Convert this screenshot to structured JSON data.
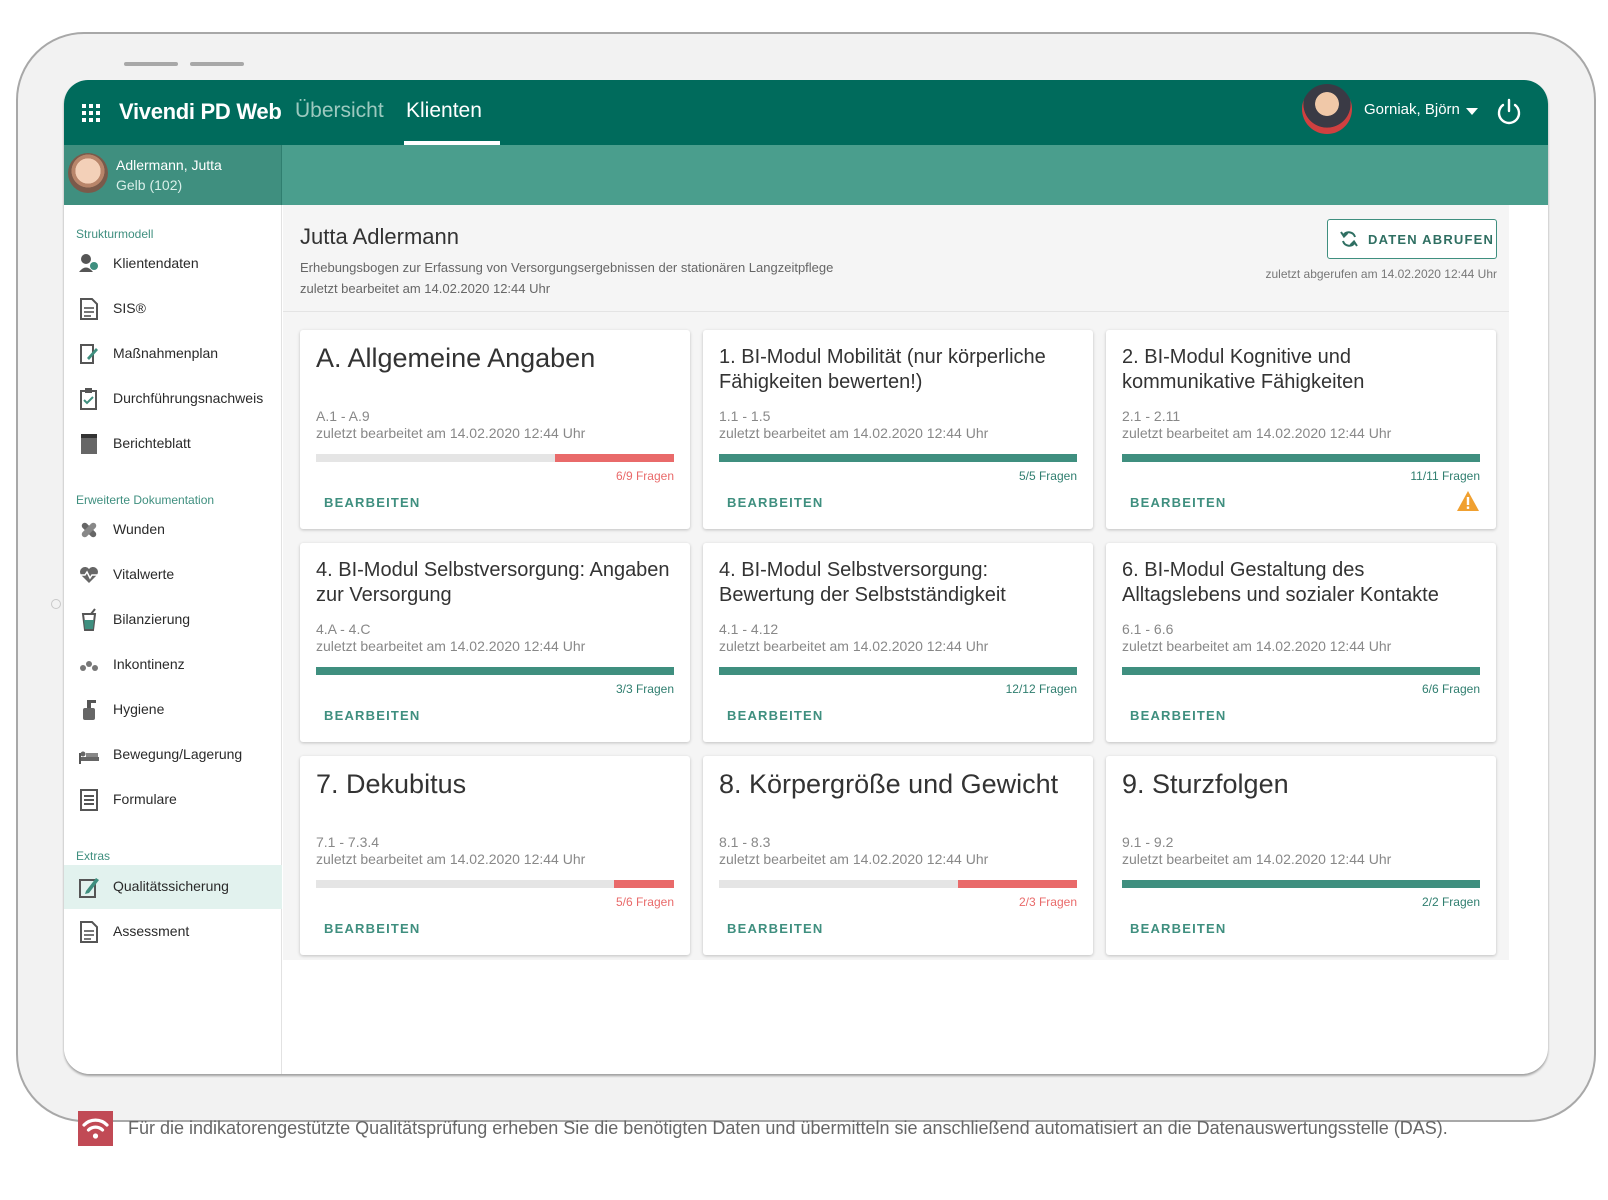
{
  "app": {
    "title": "Vivendi PD Web",
    "nav": [
      {
        "label": "Übersicht",
        "active": false
      },
      {
        "label": "Klienten",
        "active": true
      }
    ],
    "user_name": "Gorniak, Björn"
  },
  "client": {
    "name": "Adlermann, Jutta",
    "sub": "Gelb (102)"
  },
  "sidebar": {
    "sections": {
      "struktur": "Strukturmodell",
      "erweitert": "Erweiterte Dokumentation",
      "extras": "Extras"
    },
    "items": [
      {
        "label": "Klientendaten",
        "icon": "client-data-icon"
      },
      {
        "label": "SIS®",
        "icon": "document-icon"
      },
      {
        "label": "Maßnahmenplan",
        "icon": "plan-icon"
      },
      {
        "label": "Durchführungsnachweis",
        "icon": "clipboard-check-icon"
      },
      {
        "label": "Berichteblatt",
        "icon": "report-icon"
      },
      {
        "label": "Wunden",
        "icon": "bandage-icon"
      },
      {
        "label": "Vitalwerte",
        "icon": "heart-pulse-icon"
      },
      {
        "label": "Bilanzierung",
        "icon": "drink-icon"
      },
      {
        "label": "Inkontinenz",
        "icon": "drops-icon"
      },
      {
        "label": "Hygiene",
        "icon": "soap-icon"
      },
      {
        "label": "Bewegung/Lagerung",
        "icon": "bed-icon"
      },
      {
        "label": "Formulare",
        "icon": "form-icon"
      },
      {
        "label": "Qualitätssicherung",
        "icon": "edit-note-icon",
        "active": true
      },
      {
        "label": "Assessment",
        "icon": "document-icon"
      }
    ]
  },
  "page": {
    "title": "Jutta Adlermann",
    "subtitle": "Erhebungsbogen zur Erfassung von Versorgungsergebnissen der stationären Langzeitpflege",
    "last_edited": "zuletzt bearbeitet am 14.02.2020 12:44 Uhr",
    "fetch_button": "DATEN ABRUFEN",
    "fetch_note": "zuletzt abgerufen am 14.02.2020 12:44 Uhr"
  },
  "colors": {
    "primary": "#006b5c",
    "accent": "#3f8f7f",
    "progress_ok": "#3f8f7f",
    "progress_incomplete": "#e96a6a",
    "warning": "#f0a030"
  },
  "cards": [
    {
      "title": "A. Allgemeine Angaben",
      "range": "A.1 - A.9",
      "edited": "zuletzt bearbeitet am 14.02.2020 12:44 Uhr",
      "answered": 6,
      "total": 9,
      "count_label": "6/9 Fragen",
      "button": "BEARBEITEN",
      "complete": false,
      "big": true
    },
    {
      "title": "1. BI-Modul Mobilität (nur körperliche Fähigkeiten bewerten!)",
      "range": "1.1 - 1.5",
      "edited": "zuletzt bearbeitet am 14.02.2020 12:44 Uhr",
      "answered": 5,
      "total": 5,
      "count_label": "5/5 Fragen",
      "button": "BEARBEITEN",
      "complete": true
    },
    {
      "title": "2. BI-Modul Kognitive und kommunikative Fähigkeiten",
      "range": "2.1 - 2.11",
      "edited": "zuletzt bearbeitet am 14.02.2020 12:44 Uhr",
      "answered": 11,
      "total": 11,
      "count_label": "11/11 Fragen",
      "button": "BEARBEITEN",
      "complete": true,
      "warning": true
    },
    {
      "title": "4. BI-Modul Selbstversorgung: Angaben zur Versorgung",
      "range": "4.A - 4.C",
      "edited": "zuletzt bearbeitet am 14.02.2020 12:44 Uhr",
      "answered": 3,
      "total": 3,
      "count_label": "3/3 Fragen",
      "button": "BEARBEITEN",
      "complete": true
    },
    {
      "title": "4. BI-Modul Selbstversorgung: Bewertung der Selbstständigkeit",
      "range": "4.1 - 4.12",
      "edited": "zuletzt bearbeitet am 14.02.2020 12:44 Uhr",
      "answered": 12,
      "total": 12,
      "count_label": "12/12 Fragen",
      "button": "BEARBEITEN",
      "complete": true
    },
    {
      "title": "6. BI-Modul Gestaltung des Alltagslebens und sozialer Kontakte",
      "range": "6.1 - 6.6",
      "edited": "zuletzt bearbeitet am 14.02.2020 12:44 Uhr",
      "answered": 6,
      "total": 6,
      "count_label": "6/6 Fragen",
      "button": "BEARBEITEN",
      "complete": true
    },
    {
      "title": "7. Dekubitus",
      "range": "7.1 - 7.3.4",
      "edited": "zuletzt bearbeitet am 14.02.2020 12:44 Uhr",
      "answered": 5,
      "total": 6,
      "count_label": "5/6 Fragen",
      "button": "BEARBEITEN",
      "complete": false,
      "big": true
    },
    {
      "title": "8. Körpergröße und Gewicht",
      "range": "8.1 - 8.3",
      "edited": "zuletzt bearbeitet am 14.02.2020 12:44 Uhr",
      "answered": 2,
      "total": 3,
      "count_label": "2/3 Fragen",
      "button": "BEARBEITEN",
      "complete": false,
      "big": true
    },
    {
      "title": "9. Sturzfolgen",
      "range": "9.1 - 9.2",
      "edited": "zuletzt bearbeitet am 14.02.2020 12:44 Uhr",
      "answered": 2,
      "total": 2,
      "count_label": "2/2 Fragen",
      "button": "BEARBEITEN",
      "complete": true,
      "big": true
    }
  ],
  "footer": {
    "text": "Für die indikatorengestützte Qualitätsprüfung erheben Sie die benötigten Daten und übermitteln sie anschließend automatisiert an die Datenauswertungsstelle (DAS).",
    "icon": "wifi-icon"
  }
}
